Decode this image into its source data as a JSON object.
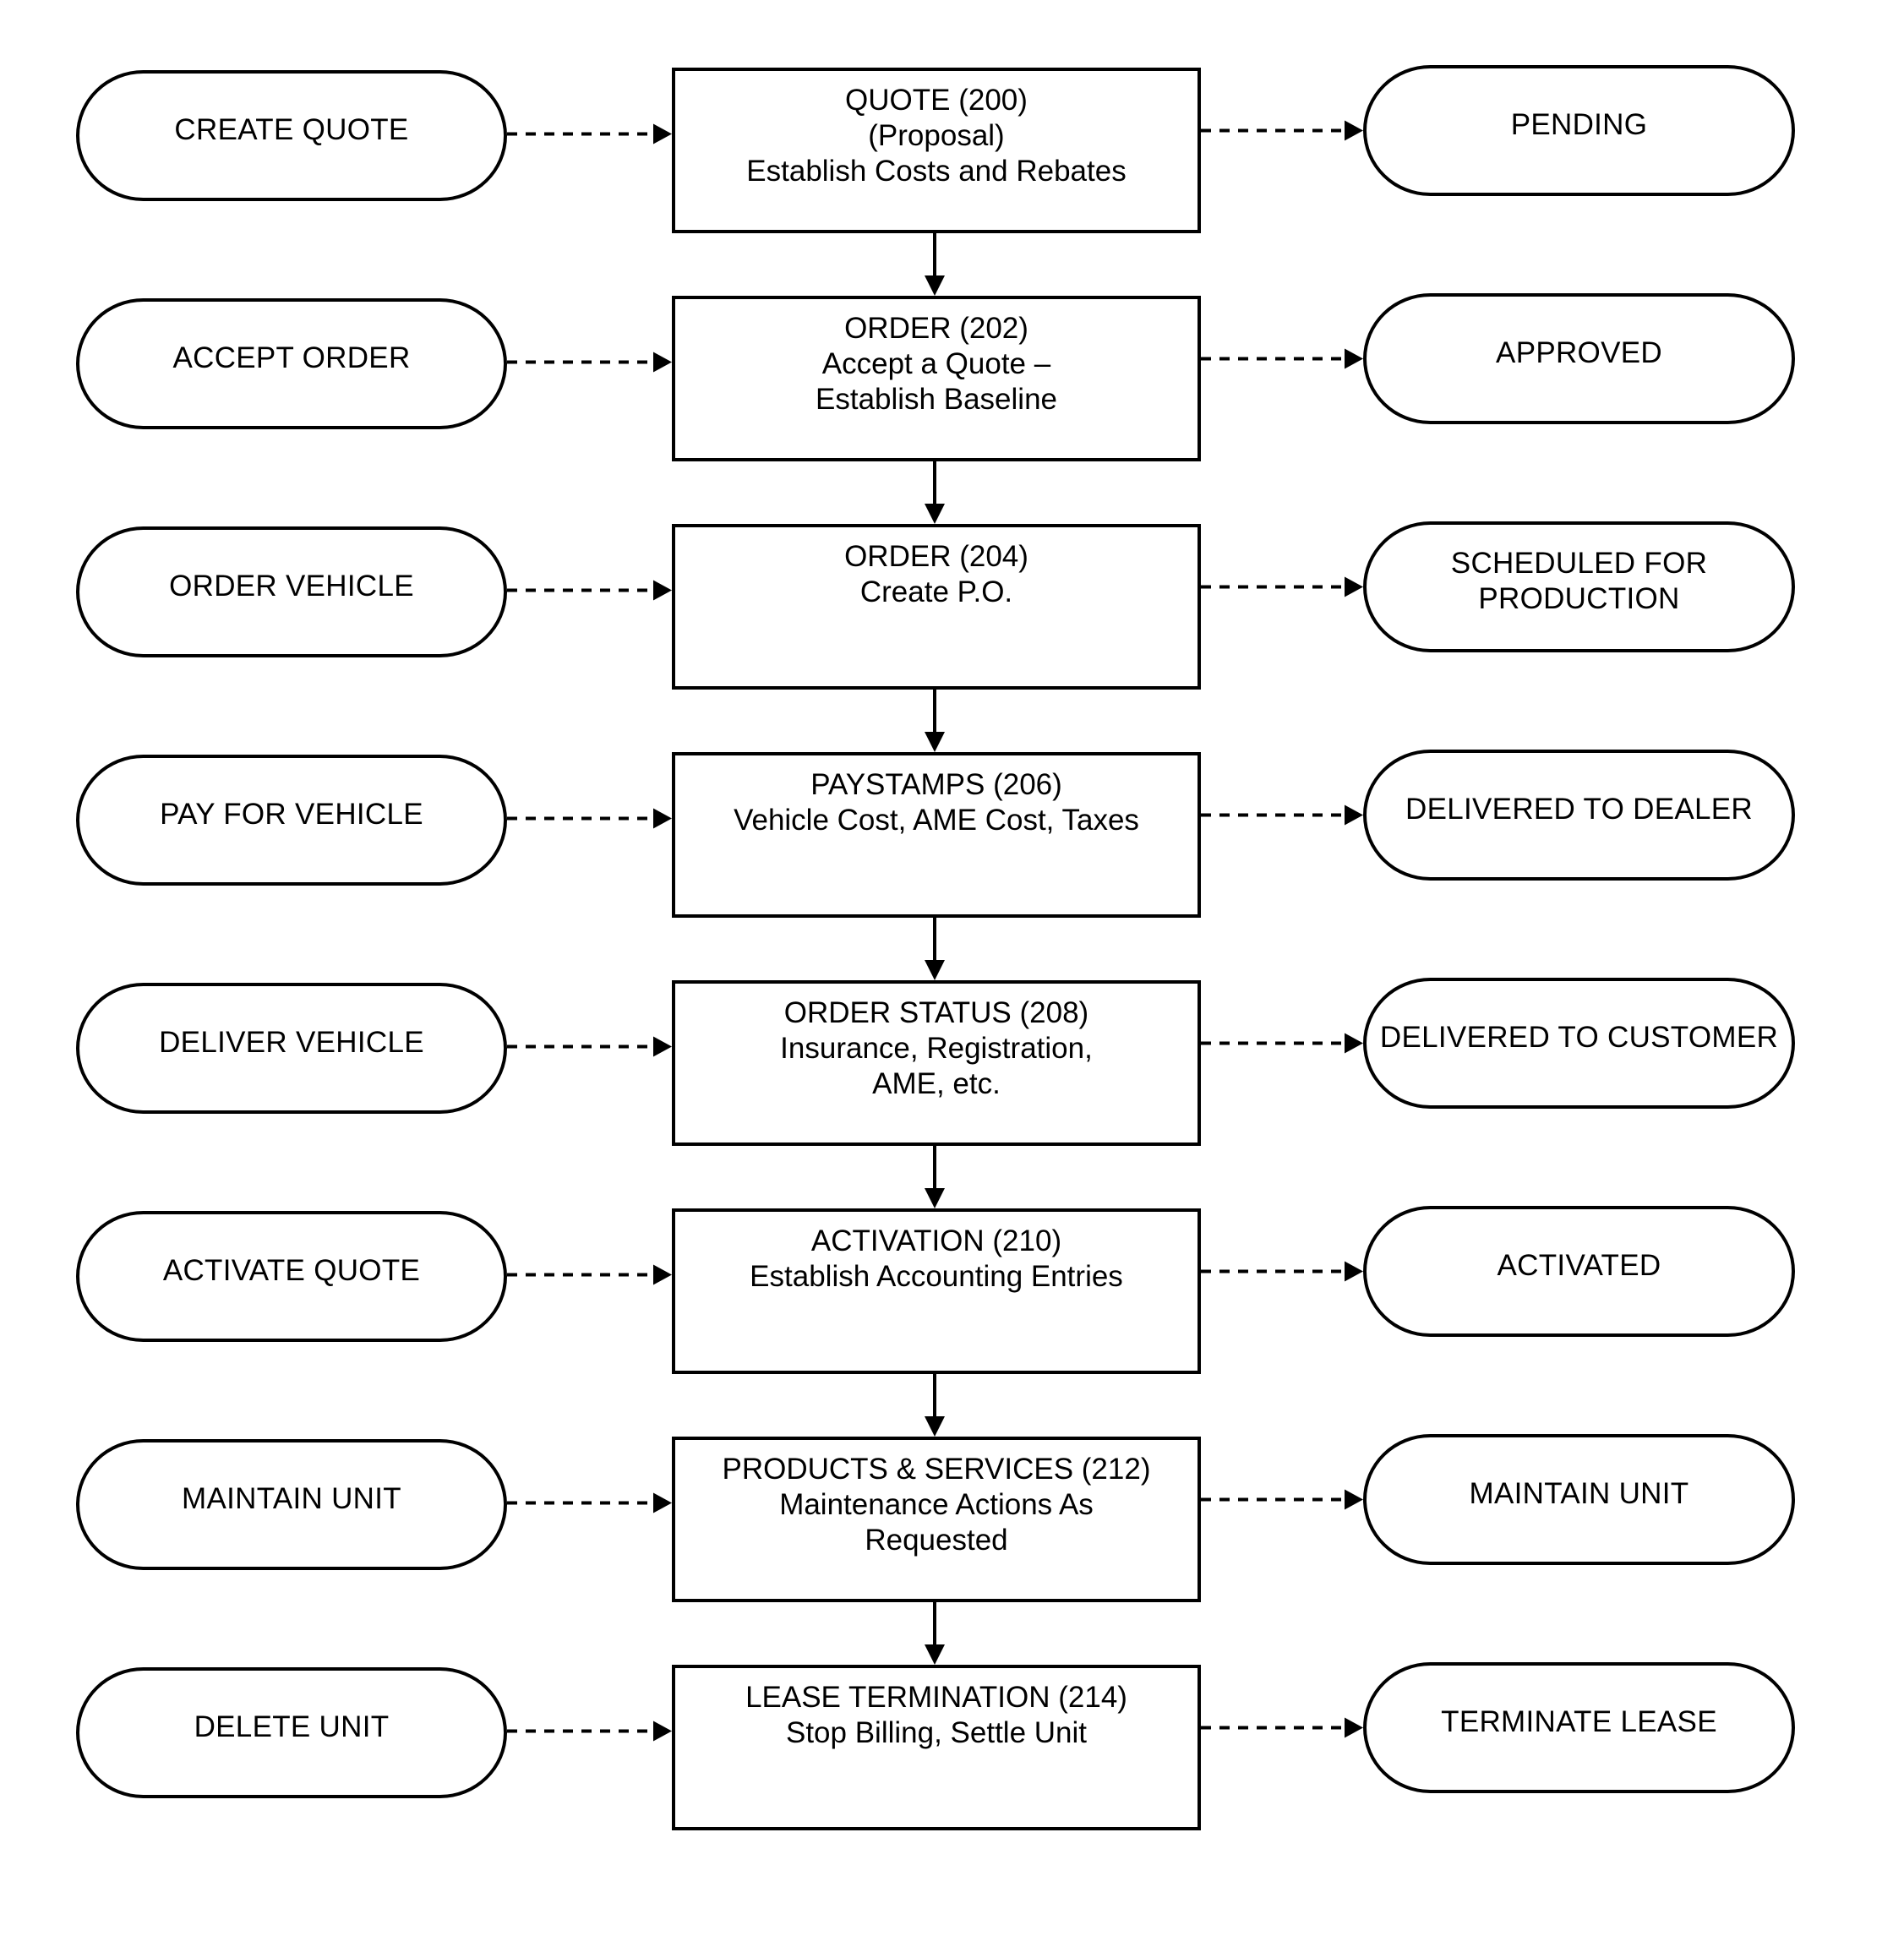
{
  "diagram": {
    "type": "flowchart",
    "rows": [
      {
        "action": "CREATE QUOTE",
        "step": {
          "title": "QUOTE (200)",
          "lines": [
            "(Proposal)",
            "Establish Costs and Rebates"
          ]
        },
        "status": [
          "PENDING"
        ]
      },
      {
        "action": "ACCEPT ORDER",
        "step": {
          "title": "ORDER (202)",
          "lines": [
            "Accept a Quote –",
            "Establish Baseline"
          ]
        },
        "status": [
          "APPROVED"
        ]
      },
      {
        "action": "ORDER VEHICLE",
        "step": {
          "title": "ORDER (204)",
          "lines": [
            "Create P.O."
          ]
        },
        "status": [
          "SCHEDULED FOR",
          "PRODUCTION"
        ]
      },
      {
        "action": "PAY FOR VEHICLE",
        "step": {
          "title": "PAYSTAMPS (206)",
          "lines": [
            "Vehicle Cost, AME Cost, Taxes"
          ]
        },
        "status": [
          "DELIVERED TO DEALER"
        ]
      },
      {
        "action": "DELIVER VEHICLE",
        "step": {
          "title": "ORDER STATUS (208)",
          "lines": [
            "Insurance, Registration,",
            "AME, etc."
          ]
        },
        "status": [
          "DELIVERED TO CUSTOMER"
        ]
      },
      {
        "action": "ACTIVATE QUOTE",
        "step": {
          "title": "ACTIVATION (210)",
          "lines": [
            "Establish Accounting Entries"
          ]
        },
        "status": [
          "ACTIVATED"
        ]
      },
      {
        "action": "MAINTAIN UNIT",
        "step": {
          "title": "PRODUCTS & SERVICES (212)",
          "lines": [
            "Maintenance Actions As",
            "Requested"
          ]
        },
        "status": [
          "MAINTAIN UNIT"
        ]
      },
      {
        "action": "DELETE UNIT",
        "step": {
          "title": "LEASE TERMINATION (214)",
          "lines": [
            "Stop Billing, Settle Unit"
          ]
        },
        "status": [
          "TERMINATE LEASE"
        ]
      }
    ],
    "edges": {
      "action_to_step": "dashed-arrow",
      "step_to_status": "dashed-arrow",
      "step_to_next_step": "solid-arrow"
    },
    "colors": {
      "stroke": "#000000",
      "fill": "#ffffff",
      "text": "#000000"
    }
  }
}
